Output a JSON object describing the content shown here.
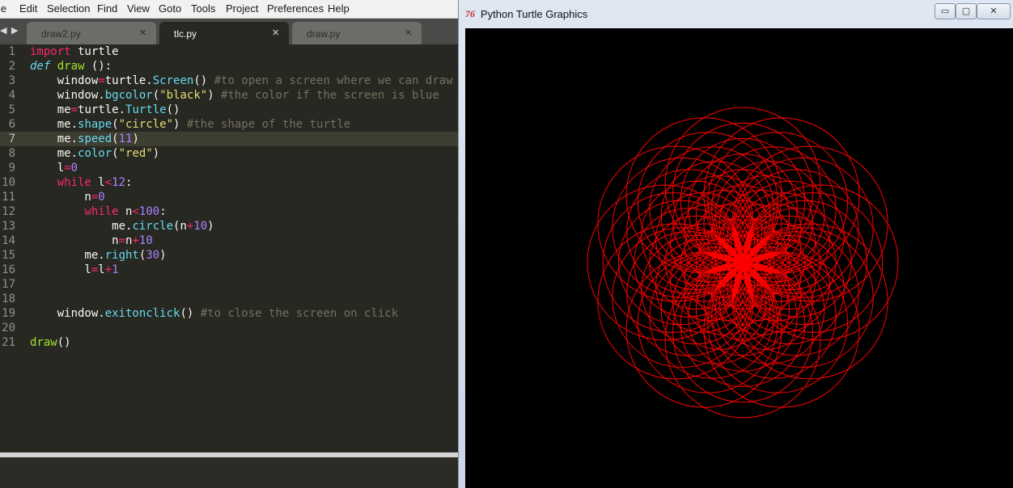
{
  "editor": {
    "menu": [
      "le",
      "Edit",
      "Selection",
      "Find",
      "View",
      "Goto",
      "Tools",
      "Project",
      "Preferences",
      "Help"
    ],
    "tab_nav": "◀ ▶",
    "tabs": [
      {
        "label": "draw2.py",
        "close": "×"
      },
      {
        "label": "tlc.py",
        "close": "×"
      },
      {
        "label": "draw.py",
        "close": "×"
      }
    ],
    "lines": [
      {
        "num": "1",
        "html": "<span class='k'>import</span> turtle"
      },
      {
        "num": "2",
        "html": "<span class='d'>def</span> <span class='f'>draw</span> ():"
      },
      {
        "num": "3",
        "html": "    window<span class='o'>=</span>turtle.<span class='b'>Screen</span>() <span class='c'>#to open a screen where we can draw</span>"
      },
      {
        "num": "4",
        "html": "    window.<span class='b'>bgcolor</span>(<span class='s'>\"black\"</span>) <span class='c'>#the color if the screen is blue</span>"
      },
      {
        "num": "5",
        "html": "    me<span class='o'>=</span>turtle.<span class='b'>Turtle</span>()"
      },
      {
        "num": "6",
        "html": "    me.<span class='b'>shape</span>(<span class='s'>\"circle\"</span>) <span class='c'>#the shape of the turtle</span>"
      },
      {
        "num": "7",
        "html": "    me.<span class='b'>speed</span>(<span class='n'>11</span>)"
      },
      {
        "num": "8",
        "html": "    me.<span class='b'>color</span>(<span class='s'>\"red\"</span>)"
      },
      {
        "num": "9",
        "html": "    l<span class='o'>=</span><span class='n'>0</span>"
      },
      {
        "num": "10",
        "html": "    <span class='k'>while</span> l<span class='o'>&lt;</span><span class='n'>12</span>:"
      },
      {
        "num": "11",
        "html": "        n<span class='o'>=</span><span class='n'>0</span>"
      },
      {
        "num": "12",
        "html": "        <span class='k'>while</span> n<span class='o'>&lt;</span><span class='n'>100</span>:"
      },
      {
        "num": "13",
        "html": "            me.<span class='b'>circle</span>(n<span class='o'>+</span><span class='n'>10</span>)"
      },
      {
        "num": "14",
        "html": "            n<span class='o'>=</span>n<span class='o'>+</span><span class='n'>10</span>"
      },
      {
        "num": "15",
        "html": "        me.<span class='b'>right</span>(<span class='n'>30</span>)"
      },
      {
        "num": "16",
        "html": "        l<span class='o'>=</span>l<span class='o'>+</span><span class='n'>1</span>"
      },
      {
        "num": "17",
        "html": ""
      },
      {
        "num": "18",
        "html": ""
      },
      {
        "num": "19",
        "html": "    window.<span class='b'>exitonclick</span>() <span class='c'>#to close the screen on click</span>"
      },
      {
        "num": "20",
        "html": ""
      },
      {
        "num": "21",
        "html": "<span class='f'>draw</span>()"
      }
    ],
    "current_line": 7
  },
  "turtle_window": {
    "title": "Python Turtle Graphics",
    "icon": "tk-feather-icon",
    "icon_text": "76",
    "buttons": {
      "minimize": "▭",
      "maximize": "▢",
      "close": "✕"
    },
    "background": "#000000",
    "pen_color": "#ff0000",
    "pattern": {
      "turns": 12,
      "turn_degrees": 30,
      "radii_start": 10,
      "radii_stop": 100,
      "radii_step": 10
    }
  }
}
